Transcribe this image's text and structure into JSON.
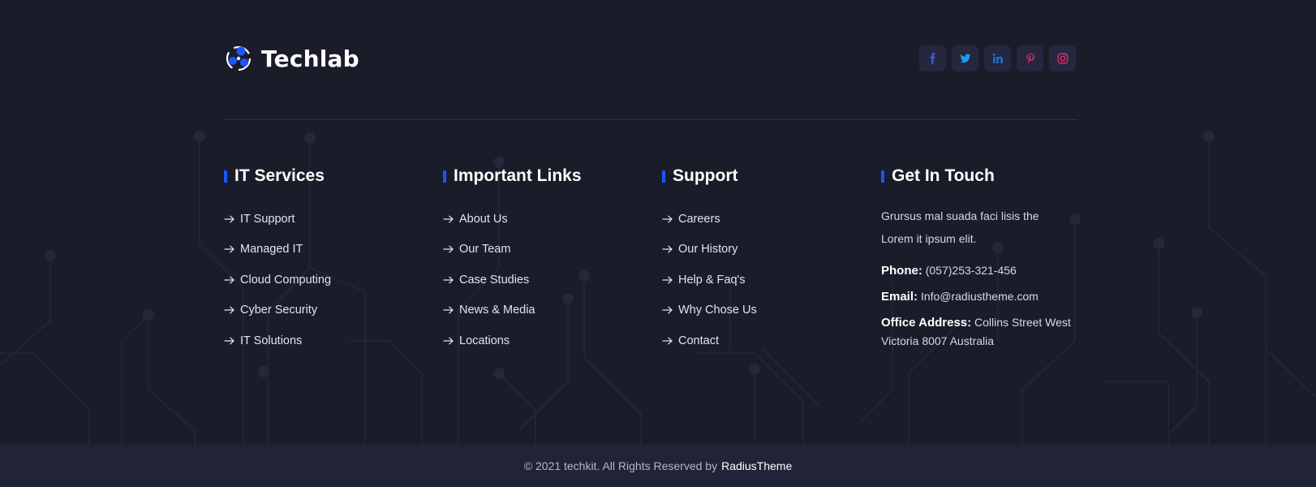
{
  "brand": {
    "name": "Techlab",
    "icon": "atom-logo-icon",
    "accent_color": "#1c55ff"
  },
  "socials": [
    {
      "name": "facebook",
      "glyph": "f",
      "color": "#3b5bd6"
    },
    {
      "name": "twitter",
      "glyph": "t",
      "color": "#1d9bf0"
    },
    {
      "name": "linkedin",
      "glyph": "in",
      "color": "#1f6fd1"
    },
    {
      "name": "pinterest",
      "glyph": "p",
      "color": "#e0245e"
    },
    {
      "name": "instagram",
      "glyph": "ig",
      "color": "#e1306c"
    }
  ],
  "columns": [
    {
      "title": "IT Services",
      "links": [
        "IT Support",
        "Managed IT",
        "Cloud Computing",
        "Cyber Security",
        "IT Solutions"
      ]
    },
    {
      "title": "Important Links",
      "links": [
        "About Us",
        "Our Team",
        "Case Studies",
        "News & Media",
        "Locations"
      ]
    },
    {
      "title": "Support",
      "links": [
        "Careers",
        "Our History",
        "Help & Faq's",
        "Why Chose Us",
        "Contact"
      ]
    }
  ],
  "contact": {
    "title": "Get In Touch",
    "description": "Grursus mal suada faci lisis the Lorem it ipsum elit.",
    "phone_label": "Phone:",
    "phone": "(057)253-321-456",
    "email_label": "Email:",
    "email": "Info@radiustheme.com",
    "address_label": "Office Address:",
    "address": "Collins Street West Victoria 8007 Australia"
  },
  "footer": {
    "copyright": "© 2021 techkit. All Rights Reserved by",
    "brand_link": "RadiusTheme"
  }
}
